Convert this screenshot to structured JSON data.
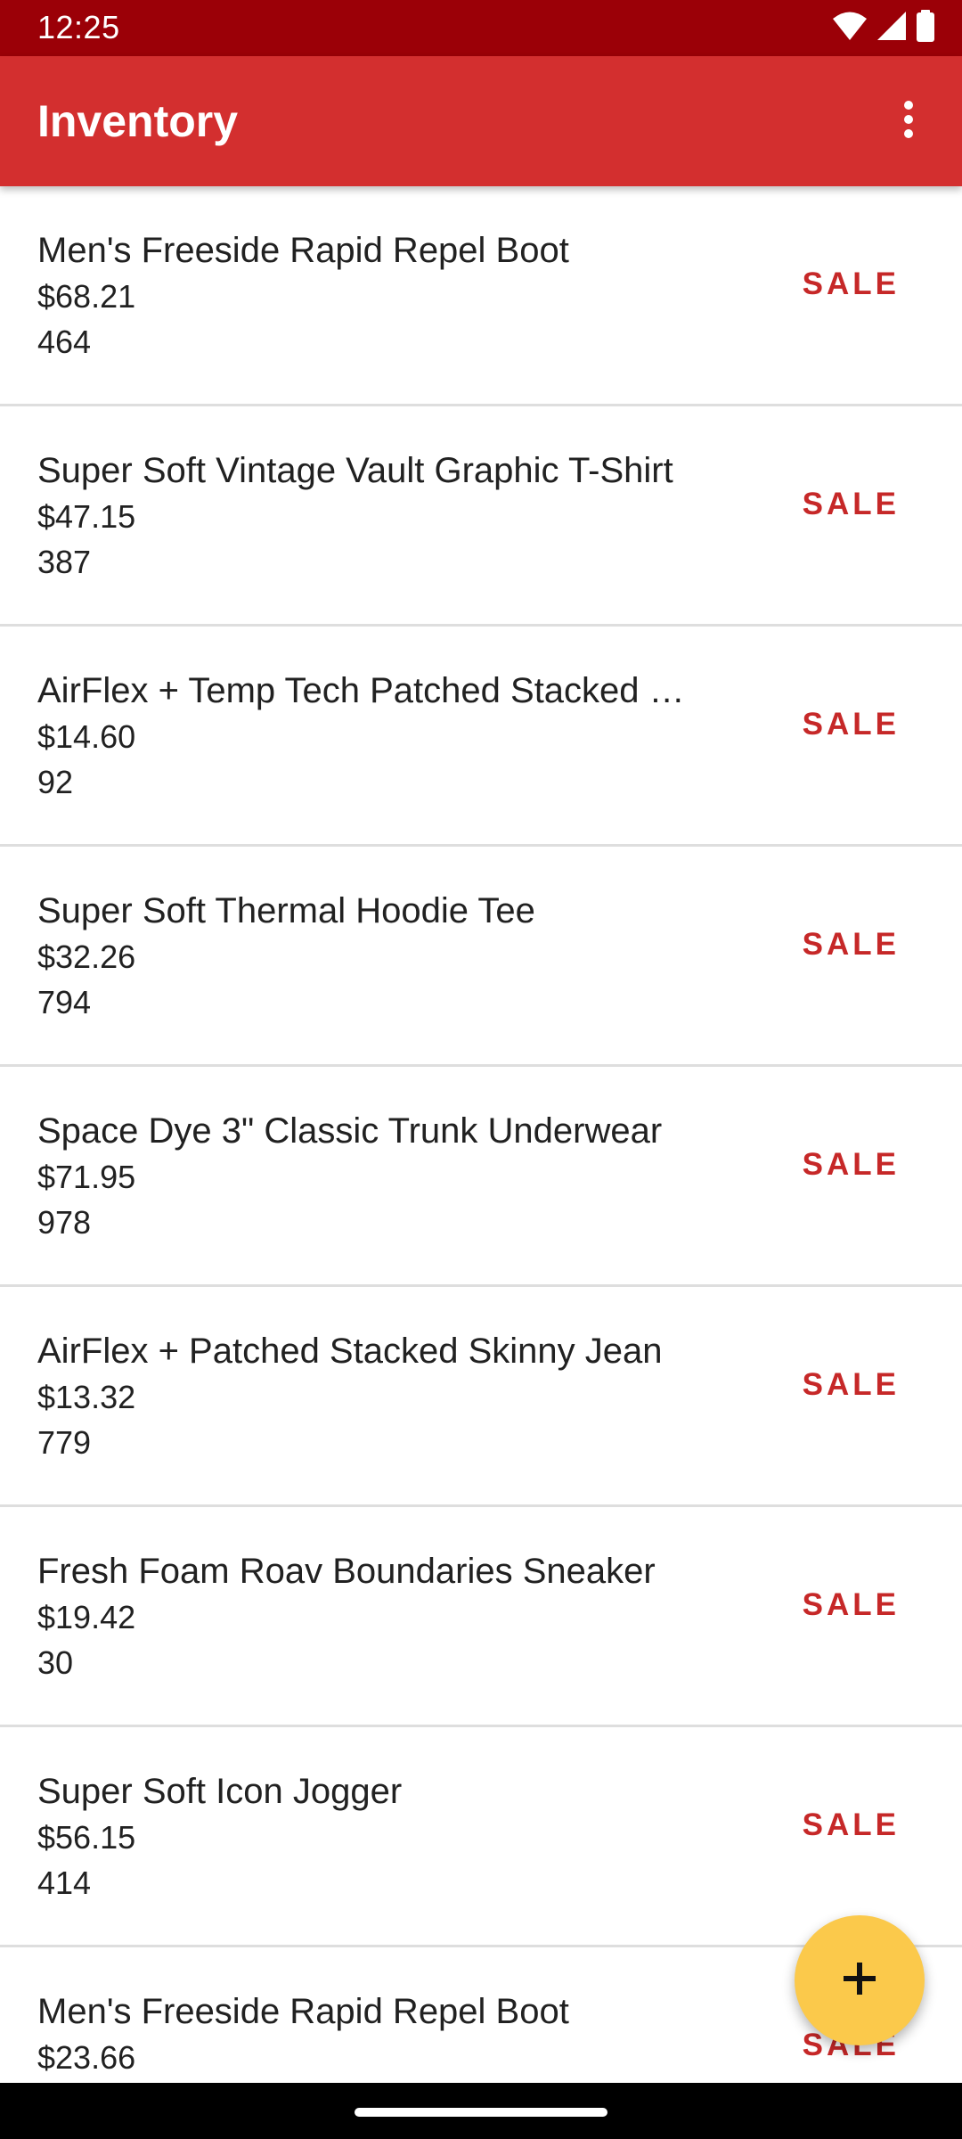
{
  "status_bar": {
    "time": "12:25",
    "icons": [
      "wifi-icon",
      "cellular-signal-icon",
      "battery-icon"
    ]
  },
  "app_bar": {
    "title": "Inventory",
    "overflow_icon": "more-vert-icon"
  },
  "items": [
    {
      "name": "Men's Freeside Rapid Repel Boot",
      "price": "$68.21",
      "quantity": "464",
      "action": "SALE"
    },
    {
      "name": "Super Soft Vintage Vault Graphic T-Shirt",
      "price": "$47.15",
      "quantity": "387",
      "action": "SALE"
    },
    {
      "name": "AirFlex + Temp Tech Patched Stacked …",
      "price": "$14.60",
      "quantity": "92",
      "action": "SALE"
    },
    {
      "name": "Super Soft Thermal Hoodie Tee",
      "price": "$32.26",
      "quantity": "794",
      "action": "SALE"
    },
    {
      "name": "Space Dye 3\" Classic Trunk Underwear",
      "price": "$71.95",
      "quantity": "978",
      "action": "SALE"
    },
    {
      "name": "AirFlex + Patched Stacked Skinny Jean",
      "price": "$13.32",
      "quantity": "779",
      "action": "SALE"
    },
    {
      "name": "Fresh Foam Roav Boundaries Sneaker",
      "price": "$19.42",
      "quantity": "30",
      "action": "SALE"
    },
    {
      "name": "Super Soft Icon Jogger",
      "price": "$56.15",
      "quantity": "414",
      "action": "SALE"
    },
    {
      "name": "Men's Freeside Rapid Repel Boot",
      "price": "$23.66",
      "quantity": "",
      "action": "SALE"
    }
  ],
  "fab": {
    "icon": "add-icon"
  },
  "colors": {
    "status_bar": "#9b0007",
    "app_bar": "#d32f2f",
    "accent_text": "#c62828",
    "fab": "#fbc94b"
  }
}
